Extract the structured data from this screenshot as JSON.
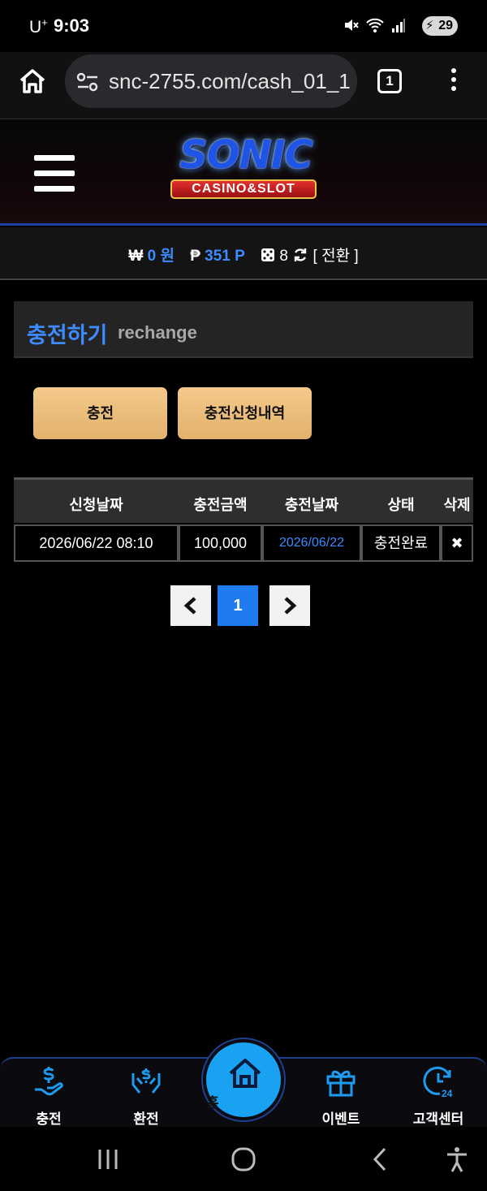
{
  "status": {
    "carrier": "U",
    "carrier_sup": "+",
    "time": "9:03",
    "battery": "29"
  },
  "browser": {
    "url": "snc-2755.com/cash_01_1",
    "tab_count": "1"
  },
  "site": {
    "logo_main": "SONIC",
    "logo_sub": "CASINO&SLOT"
  },
  "balance": {
    "won_symbol": "₩",
    "won_value": "0 원",
    "point_symbol": "₱",
    "point_value": "351 P",
    "chip_count": "8",
    "switch_label": "[ 전환 ]"
  },
  "section": {
    "title_ko": "충전하기",
    "title_en": "rechange"
  },
  "buttons": {
    "charge": "충전",
    "history": "충전신청내역"
  },
  "table": {
    "headers": [
      "신청날짜",
      "충전금액",
      "충전날짜",
      "상태",
      "삭제"
    ],
    "rows": [
      {
        "request_date": "2026/06/22 08:10",
        "amount": "100,000",
        "charge_date": "2026/06/22",
        "status": "충전완료",
        "delete": "✖"
      }
    ]
  },
  "pagination": {
    "prev": "‹",
    "current": "1",
    "next": "›"
  },
  "bottom_nav": {
    "items": [
      "충전",
      "환전",
      "홈",
      "이벤트",
      "고객센터"
    ]
  },
  "colors": {
    "accent_blue": "#3d8bff",
    "gold": "#e9bd7a",
    "home_blue": "#1aa2f2"
  }
}
